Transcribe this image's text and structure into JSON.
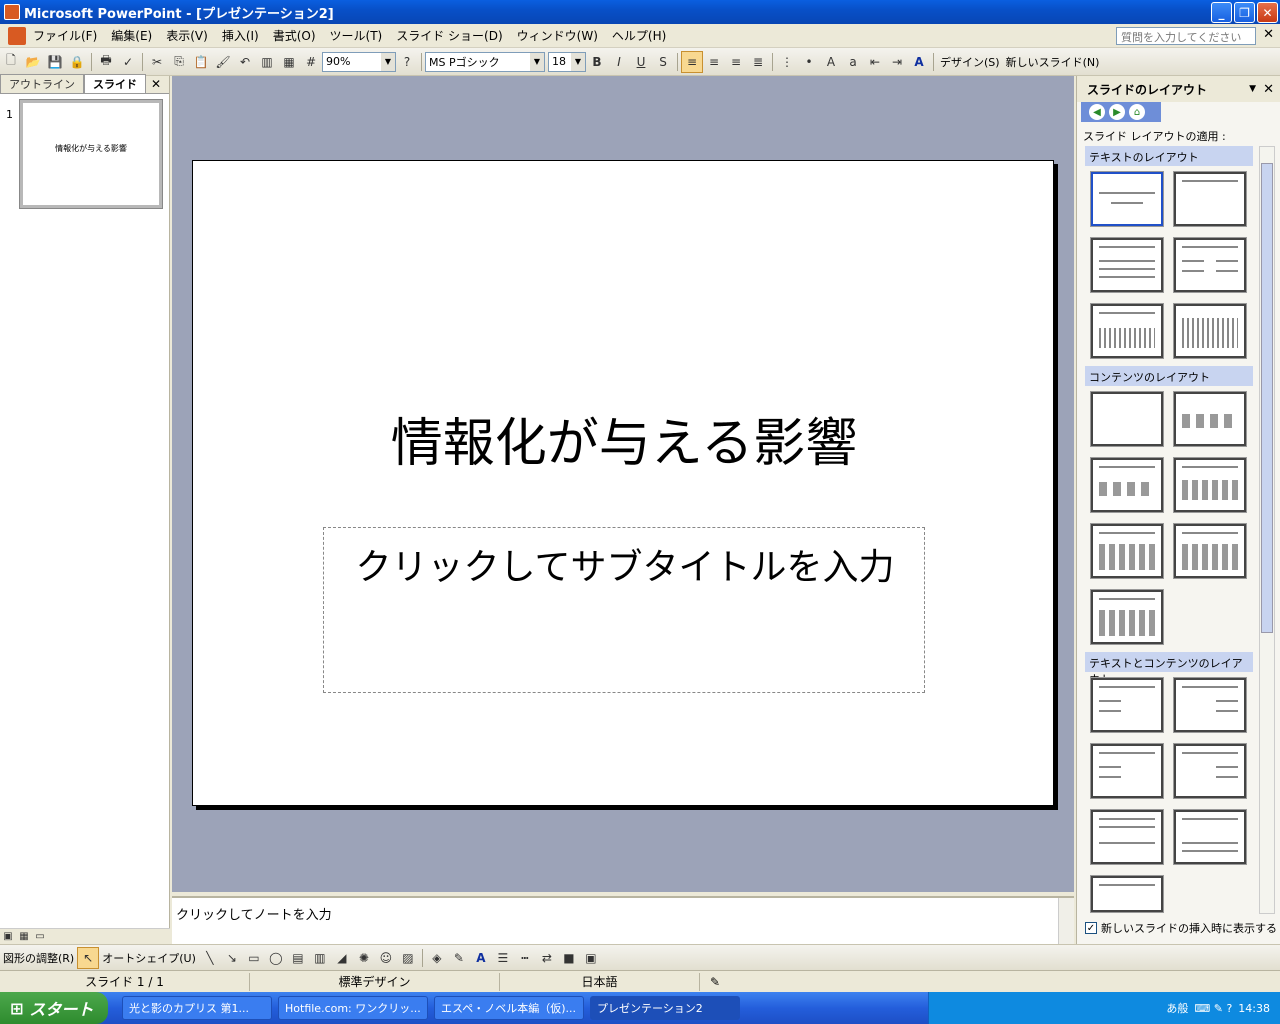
{
  "window": {
    "title": "Microsoft PowerPoint - [プレゼンテーション2]"
  },
  "menu": {
    "items": [
      "ファイル(F)",
      "編集(E)",
      "表示(V)",
      "挿入(I)",
      "書式(O)",
      "ツール(T)",
      "スライド ショー(D)",
      "ウィンドウ(W)",
      "ヘルプ(H)"
    ],
    "help_placeholder": "質問を入力してください"
  },
  "toolbar": {
    "zoom": "90%",
    "font_name": "MS Pゴシック",
    "font_size": "18",
    "bold": "B",
    "italic": "I",
    "underline": "U",
    "shadow": "S",
    "design_label": "デザイン(S)",
    "new_slide_label": "新しいスライド(N)"
  },
  "left_pane": {
    "tabs": [
      "アウトライン",
      "スライド"
    ],
    "slide_number": "1",
    "thumbnail_title": "情報化が与える影響"
  },
  "slide": {
    "title": "情報化が与える影響",
    "subtitle_placeholder": "クリックしてサブタイトルを入力"
  },
  "notes": {
    "placeholder": "クリックしてノートを入力"
  },
  "task_pane": {
    "title": "スライドのレイアウト",
    "apply_label": "スライド レイアウトの適用 :",
    "sections": [
      "テキストのレイアウト",
      "コンテンツのレイアウト",
      "テキストとコンテンツのレイアウト"
    ],
    "show_on_insert": "新しいスライドの挿入時に表示する"
  },
  "draw_toolbar": {
    "draw_label": "図形の調整(R)",
    "autoshape_label": "オートシェイプ(U)"
  },
  "status": {
    "slide": "スライド 1 / 1",
    "design": "標準デザイン",
    "language": "日本語"
  },
  "taskbar": {
    "start": "スタート",
    "tasks": [
      "光と影のカプリス 第1...",
      "Hotfile.com: ワンクリッ...",
      "エスペ・ノベル本編（仮)...",
      "プレゼンテーション2"
    ],
    "clock": "14:38"
  },
  "colors": {
    "title_bar": "#0a5fe0",
    "canvas_bg": "#9ca3b8",
    "taskbar": "#245edb",
    "start_button": "#2e8b2e"
  }
}
